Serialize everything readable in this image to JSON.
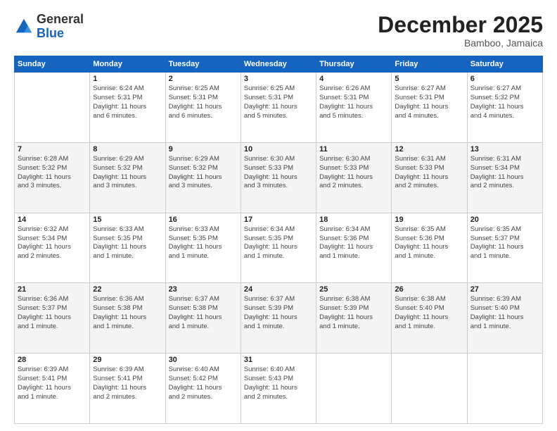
{
  "logo": {
    "general": "General",
    "blue": "Blue"
  },
  "header": {
    "month": "December 2025",
    "location": "Bamboo, Jamaica"
  },
  "days_of_week": [
    "Sunday",
    "Monday",
    "Tuesday",
    "Wednesday",
    "Thursday",
    "Friday",
    "Saturday"
  ],
  "weeks": [
    [
      {
        "day": "",
        "info": ""
      },
      {
        "day": "1",
        "info": "Sunrise: 6:24 AM\nSunset: 5:31 PM\nDaylight: 11 hours\nand 6 minutes."
      },
      {
        "day": "2",
        "info": "Sunrise: 6:25 AM\nSunset: 5:31 PM\nDaylight: 11 hours\nand 6 minutes."
      },
      {
        "day": "3",
        "info": "Sunrise: 6:25 AM\nSunset: 5:31 PM\nDaylight: 11 hours\nand 5 minutes."
      },
      {
        "day": "4",
        "info": "Sunrise: 6:26 AM\nSunset: 5:31 PM\nDaylight: 11 hours\nand 5 minutes."
      },
      {
        "day": "5",
        "info": "Sunrise: 6:27 AM\nSunset: 5:31 PM\nDaylight: 11 hours\nand 4 minutes."
      },
      {
        "day": "6",
        "info": "Sunrise: 6:27 AM\nSunset: 5:32 PM\nDaylight: 11 hours\nand 4 minutes."
      }
    ],
    [
      {
        "day": "7",
        "info": "Sunrise: 6:28 AM\nSunset: 5:32 PM\nDaylight: 11 hours\nand 3 minutes."
      },
      {
        "day": "8",
        "info": "Sunrise: 6:29 AM\nSunset: 5:32 PM\nDaylight: 11 hours\nand 3 minutes."
      },
      {
        "day": "9",
        "info": "Sunrise: 6:29 AM\nSunset: 5:32 PM\nDaylight: 11 hours\nand 3 minutes."
      },
      {
        "day": "10",
        "info": "Sunrise: 6:30 AM\nSunset: 5:33 PM\nDaylight: 11 hours\nand 3 minutes."
      },
      {
        "day": "11",
        "info": "Sunrise: 6:30 AM\nSunset: 5:33 PM\nDaylight: 11 hours\nand 2 minutes."
      },
      {
        "day": "12",
        "info": "Sunrise: 6:31 AM\nSunset: 5:33 PM\nDaylight: 11 hours\nand 2 minutes."
      },
      {
        "day": "13",
        "info": "Sunrise: 6:31 AM\nSunset: 5:34 PM\nDaylight: 11 hours\nand 2 minutes."
      }
    ],
    [
      {
        "day": "14",
        "info": "Sunrise: 6:32 AM\nSunset: 5:34 PM\nDaylight: 11 hours\nand 2 minutes."
      },
      {
        "day": "15",
        "info": "Sunrise: 6:33 AM\nSunset: 5:35 PM\nDaylight: 11 hours\nand 1 minute."
      },
      {
        "day": "16",
        "info": "Sunrise: 6:33 AM\nSunset: 5:35 PM\nDaylight: 11 hours\nand 1 minute."
      },
      {
        "day": "17",
        "info": "Sunrise: 6:34 AM\nSunset: 5:35 PM\nDaylight: 11 hours\nand 1 minute."
      },
      {
        "day": "18",
        "info": "Sunrise: 6:34 AM\nSunset: 5:36 PM\nDaylight: 11 hours\nand 1 minute."
      },
      {
        "day": "19",
        "info": "Sunrise: 6:35 AM\nSunset: 5:36 PM\nDaylight: 11 hours\nand 1 minute."
      },
      {
        "day": "20",
        "info": "Sunrise: 6:35 AM\nSunset: 5:37 PM\nDaylight: 11 hours\nand 1 minute."
      }
    ],
    [
      {
        "day": "21",
        "info": "Sunrise: 6:36 AM\nSunset: 5:37 PM\nDaylight: 11 hours\nand 1 minute."
      },
      {
        "day": "22",
        "info": "Sunrise: 6:36 AM\nSunset: 5:38 PM\nDaylight: 11 hours\nand 1 minute."
      },
      {
        "day": "23",
        "info": "Sunrise: 6:37 AM\nSunset: 5:38 PM\nDaylight: 11 hours\nand 1 minute."
      },
      {
        "day": "24",
        "info": "Sunrise: 6:37 AM\nSunset: 5:39 PM\nDaylight: 11 hours\nand 1 minute."
      },
      {
        "day": "25",
        "info": "Sunrise: 6:38 AM\nSunset: 5:39 PM\nDaylight: 11 hours\nand 1 minute."
      },
      {
        "day": "26",
        "info": "Sunrise: 6:38 AM\nSunset: 5:40 PM\nDaylight: 11 hours\nand 1 minute."
      },
      {
        "day": "27",
        "info": "Sunrise: 6:39 AM\nSunset: 5:40 PM\nDaylight: 11 hours\nand 1 minute."
      }
    ],
    [
      {
        "day": "28",
        "info": "Sunrise: 6:39 AM\nSunset: 5:41 PM\nDaylight: 11 hours\nand 1 minute."
      },
      {
        "day": "29",
        "info": "Sunrise: 6:39 AM\nSunset: 5:41 PM\nDaylight: 11 hours\nand 2 minutes."
      },
      {
        "day": "30",
        "info": "Sunrise: 6:40 AM\nSunset: 5:42 PM\nDaylight: 11 hours\nand 2 minutes."
      },
      {
        "day": "31",
        "info": "Sunrise: 6:40 AM\nSunset: 5:43 PM\nDaylight: 11 hours\nand 2 minutes."
      },
      {
        "day": "",
        "info": ""
      },
      {
        "day": "",
        "info": ""
      },
      {
        "day": "",
        "info": ""
      }
    ]
  ]
}
